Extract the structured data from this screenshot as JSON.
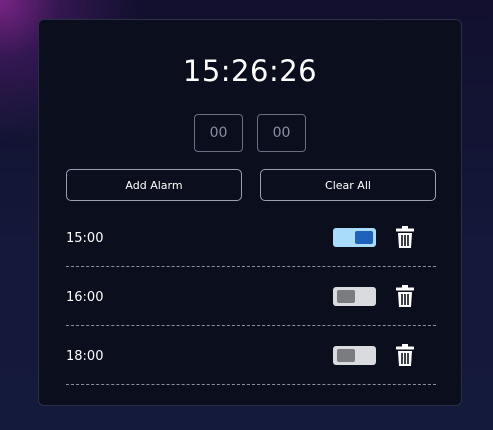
{
  "clock": {
    "time": "15:26:26"
  },
  "inputs": {
    "hours_placeholder": "00",
    "minutes_placeholder": "00"
  },
  "buttons": {
    "add_alarm": "Add Alarm",
    "clear_all": "Clear All"
  },
  "alarms": [
    {
      "time": "15:00",
      "enabled": true
    },
    {
      "time": "16:00",
      "enabled": false
    },
    {
      "time": "18:00",
      "enabled": false
    }
  ],
  "colors": {
    "card_bg": "#0b0e1c",
    "toggle_on_track": "#a9dcfb",
    "toggle_on_knob": "#1e62bc",
    "toggle_off_track": "#dadbde",
    "toggle_off_knob": "#7b7c80"
  },
  "icons": {
    "delete": "trash-icon"
  }
}
